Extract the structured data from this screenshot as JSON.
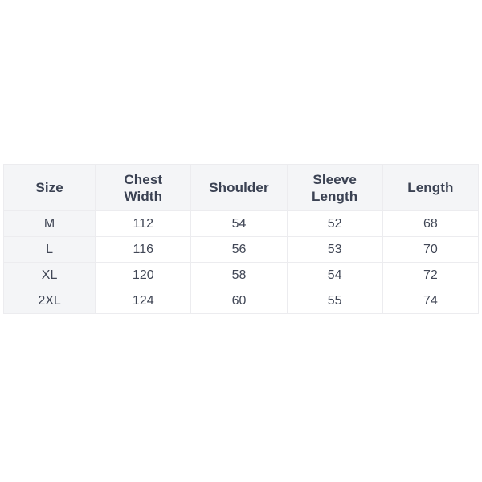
{
  "page": {
    "background_color": "#ffffff",
    "header_background_color": "#f4f5f7",
    "size_column_background_color": "#f4f5f7",
    "cell_background_color": "#ffffff",
    "border_color": "#ececef",
    "header_text_color": "#3b4253",
    "body_text_color": "#414756"
  },
  "chart_data": {
    "type": "table",
    "title": "",
    "columns": [
      "Size",
      "Chest Width",
      "Shoulder",
      "Sleeve Length",
      "Length"
    ],
    "column_lines": [
      [
        "Size"
      ],
      [
        "Chest",
        "Width"
      ],
      [
        "Shoulder"
      ],
      [
        "Sleeve",
        "Length"
      ],
      [
        "Length"
      ]
    ],
    "rows": [
      [
        "M",
        "112",
        "54",
        "52",
        "68"
      ],
      [
        "L",
        "116",
        "56",
        "53",
        "70"
      ],
      [
        "XL",
        "120",
        "58",
        "54",
        "72"
      ],
      [
        "2XL",
        "124",
        "60",
        "55",
        "74"
      ]
    ]
  },
  "table": {
    "headers": {
      "size": "Size",
      "chest_width_line1": "Chest",
      "chest_width_line2": "Width",
      "shoulder": "Shoulder",
      "sleeve_length_line1": "Sleeve",
      "sleeve_length_line2": "Length",
      "length": "Length"
    },
    "rows": [
      {
        "size": "M",
        "chest_width": "112",
        "shoulder": "54",
        "sleeve_length": "52",
        "length": "68"
      },
      {
        "size": "L",
        "chest_width": "116",
        "shoulder": "56",
        "sleeve_length": "53",
        "length": "70"
      },
      {
        "size": "XL",
        "chest_width": "120",
        "shoulder": "58",
        "sleeve_length": "54",
        "length": "72"
      },
      {
        "size": "2XL",
        "chest_width": "124",
        "shoulder": "60",
        "sleeve_length": "55",
        "length": "74"
      }
    ]
  }
}
